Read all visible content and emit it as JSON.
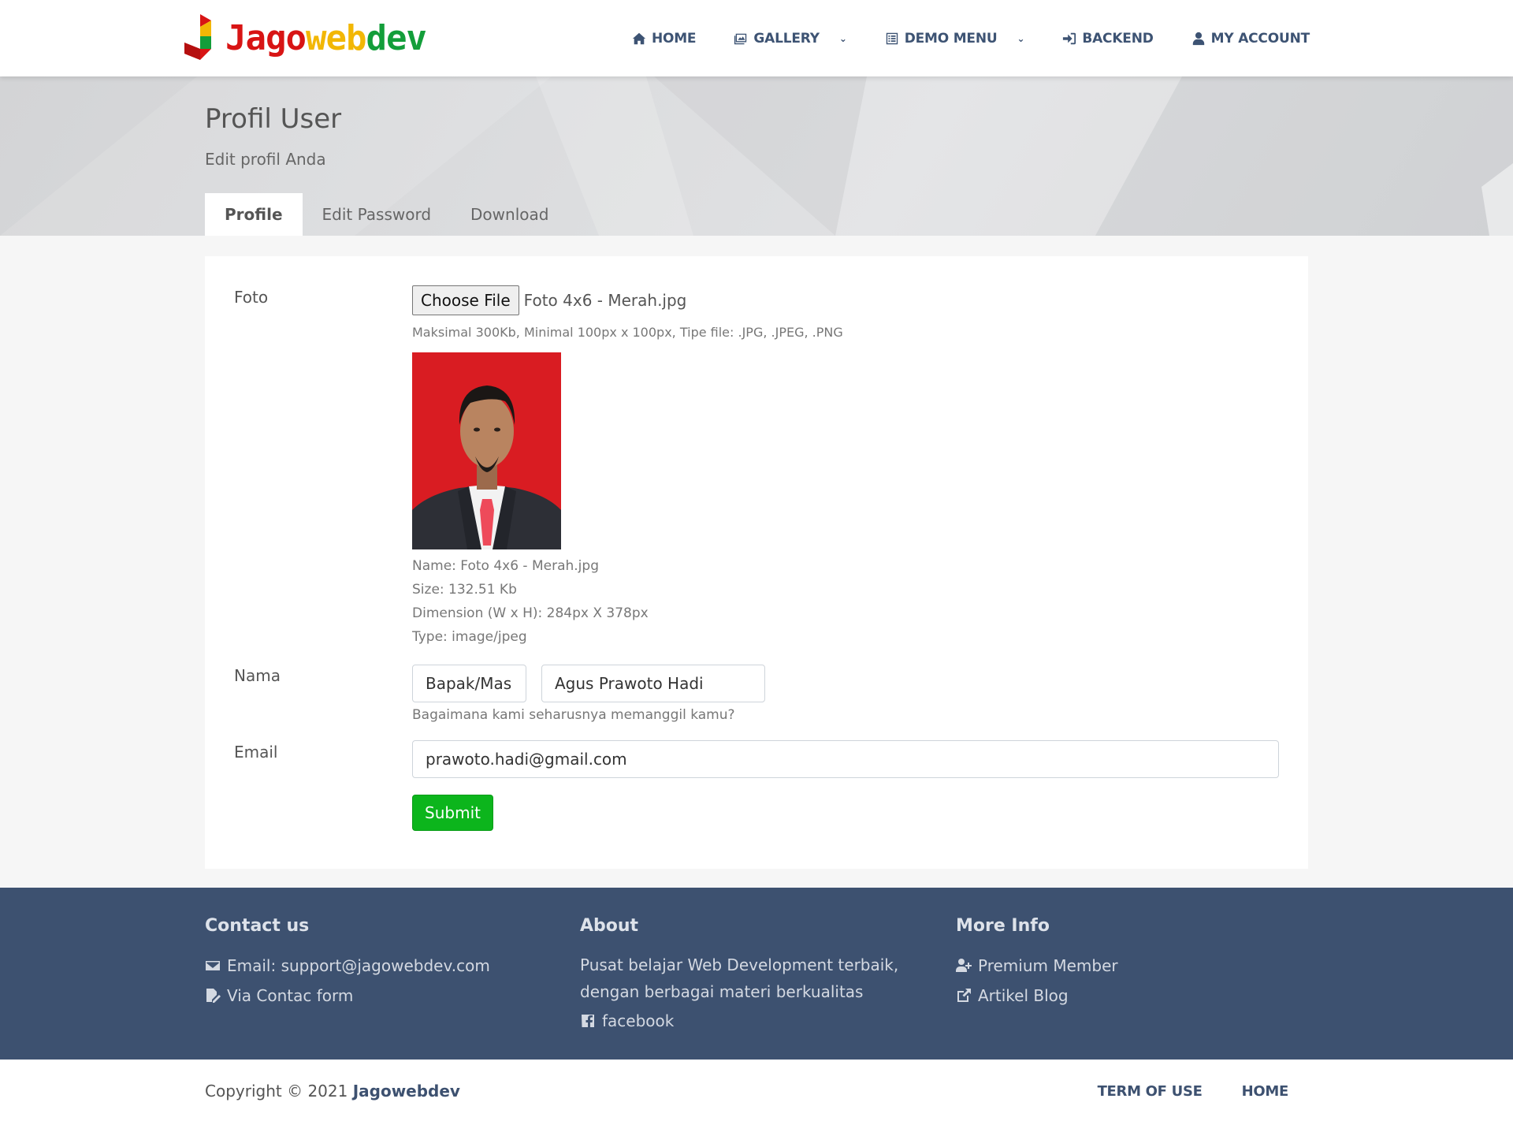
{
  "brand": {
    "part1": "Jago",
    "part2": "web",
    "part3": "dev"
  },
  "nav": {
    "items": [
      {
        "label": "HOME",
        "icon": "home-icon"
      },
      {
        "label": "GALLERY",
        "icon": "image-icon",
        "dropdown": true
      },
      {
        "label": "DEMO MENU",
        "icon": "list-icon",
        "dropdown": true
      },
      {
        "label": "BACKEND",
        "icon": "sign-in-icon"
      },
      {
        "label": "MY ACCOUNT",
        "icon": "user-icon"
      }
    ],
    "chevron": "⌄"
  },
  "hero": {
    "title": "Profil User",
    "subtitle": "Edit profil Anda",
    "tabs": [
      {
        "label": "Profile",
        "active": true
      },
      {
        "label": "Edit Password",
        "active": false
      },
      {
        "label": "Download",
        "active": false
      }
    ]
  },
  "form": {
    "foto": {
      "label": "Foto",
      "choose_button": "Choose File",
      "file_name": "Foto 4x6 - Merah.jpg",
      "hint": "Maksimal 300Kb, Minimal 100px x 100px, Tipe file: .JPG, .JPEG, .PNG",
      "meta": {
        "name": "Name: Foto 4x6 - Merah.jpg",
        "size": "Size: 132.51 Kb",
        "dimension": "Dimension (W x H): 284px X 378px",
        "type": "Type: image/jpeg"
      }
    },
    "nama": {
      "label": "Nama",
      "salutation": "Bapak/Mas",
      "full_name": "Agus Prawoto Hadi",
      "hint": "Bagaimana kami seharusnya memanggil kamu?"
    },
    "email": {
      "label": "Email",
      "value": "prawoto.hadi@gmail.com"
    },
    "submit_label": "Submit"
  },
  "footer": {
    "contact": {
      "heading": "Contact us",
      "email": "Email: support@jagowebdev.com",
      "form": "Via Contac form"
    },
    "about": {
      "heading": "About",
      "line1": "Pusat belajar Web Development terbaik,",
      "line2": "dengan berbagai materi berkualitas",
      "facebook": "facebook"
    },
    "more": {
      "heading": "More Info",
      "premium": "Premium Member",
      "blog": "Artikel Blog"
    }
  },
  "bottom": {
    "copyright": "Copyright © 2021 ",
    "brand": "Jagowebdev",
    "links": [
      "TERM OF USE",
      "HOME"
    ]
  },
  "colors": {
    "nav_text": "#3d5373",
    "footer_bg": "#3d5170",
    "submit_bg": "#0cb51c",
    "brand_red": "#d81414",
    "brand_yellow": "#f2b705",
    "brand_green": "#139e3a"
  }
}
